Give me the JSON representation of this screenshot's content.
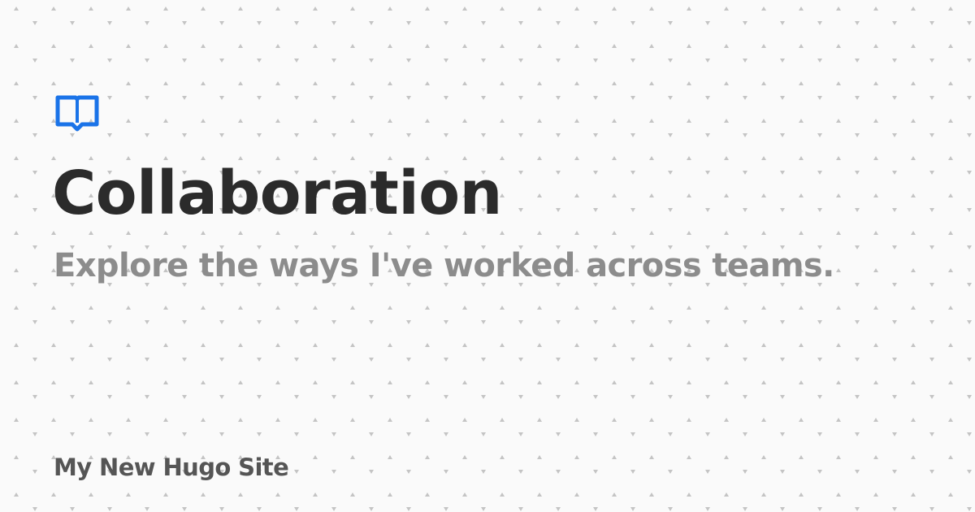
{
  "page": {
    "title": "Collaboration",
    "subtitle": "Explore the ways I've worked across teams.",
    "site_name": "My New Hugo Site",
    "logo_icon": "open-book-icon"
  },
  "colors": {
    "background": "#fafafa",
    "accent": "#1a73e8",
    "title": "#2b2b2b",
    "subtitle": "#8c8c8c",
    "site_name": "#555555",
    "pattern_dots": "#c4c4c4"
  }
}
